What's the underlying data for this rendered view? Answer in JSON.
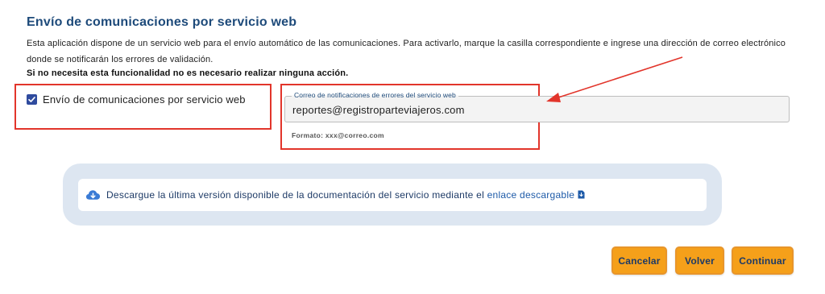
{
  "section": {
    "title": "Envío de comunicaciones por servicio web",
    "description_line1": "Esta aplicación dispone de un servicio web para el envío automático de las comunicaciones. Para activarlo, marque la casilla correspondiente e ingrese una dirección de correo electrónico",
    "description_line2": "donde se notificarán los errores de validación.",
    "note": "Si no necesita esta funcionalidad no es necesario realizar ninguna acción."
  },
  "checkbox": {
    "label": "Envío de comunicaciones por servicio web",
    "checked": true,
    "color": "#2f4b9e"
  },
  "email": {
    "legend": "Correo de notificaciones de errores del servicio web",
    "value": "reportes@registroparteviajeros.com",
    "format_hint": "Formato: xxx@correo.com"
  },
  "info": {
    "icon": "cloud-download-icon",
    "text": "Descargue la última versión disponible de la documentación del servicio mediante el",
    "link_text": "enlace descargable",
    "link_icon": "pdf-file-icon"
  },
  "buttons": {
    "cancel": "Cancelar",
    "back": "Volver",
    "continue": "Continuar",
    "color": "#f5a01a"
  },
  "annotations": {
    "highlight_color": "#e2352b"
  }
}
